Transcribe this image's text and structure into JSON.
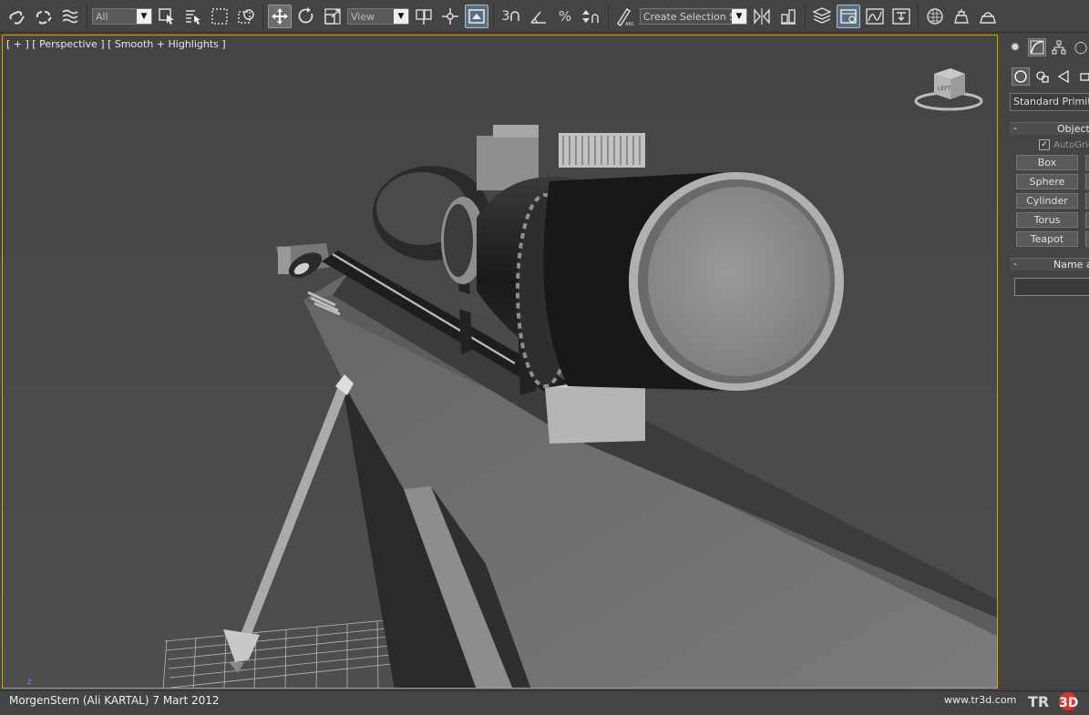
{
  "toolbar": {
    "selection_filter": "All",
    "reference_coord": "View",
    "snap_angle": "3",
    "named_selection_placeholder": "Create Selection Se"
  },
  "viewport": {
    "label": "[ + ] [ Perspective ] [ Smooth + Highlights ]",
    "viewcube_face": "LEFT",
    "axis_label": "z"
  },
  "command_panel": {
    "category": "Standard Primitives",
    "rollout_object_type": "Object Type",
    "autogrid_label": "AutoGrid",
    "autogrid_checked": "✓",
    "buttons": [
      "Box",
      "Sphere",
      "Cylinder",
      "Torus",
      "Teapot"
    ],
    "rollout_name_color": "Name and Color",
    "rollout_minus": "-"
  },
  "status": {
    "left_text": "MorgenStern (Ali KARTAL)  7 Mart 2012",
    "right_text": "www.tr3d.com",
    "logo_text_1": "TR",
    "logo_text_2": "3D"
  },
  "colors": {
    "viewport_border": "#c4a43c",
    "ui_background": "#444444",
    "viewport_background": "#4a4a4a",
    "logo_red": "#e0312a"
  }
}
